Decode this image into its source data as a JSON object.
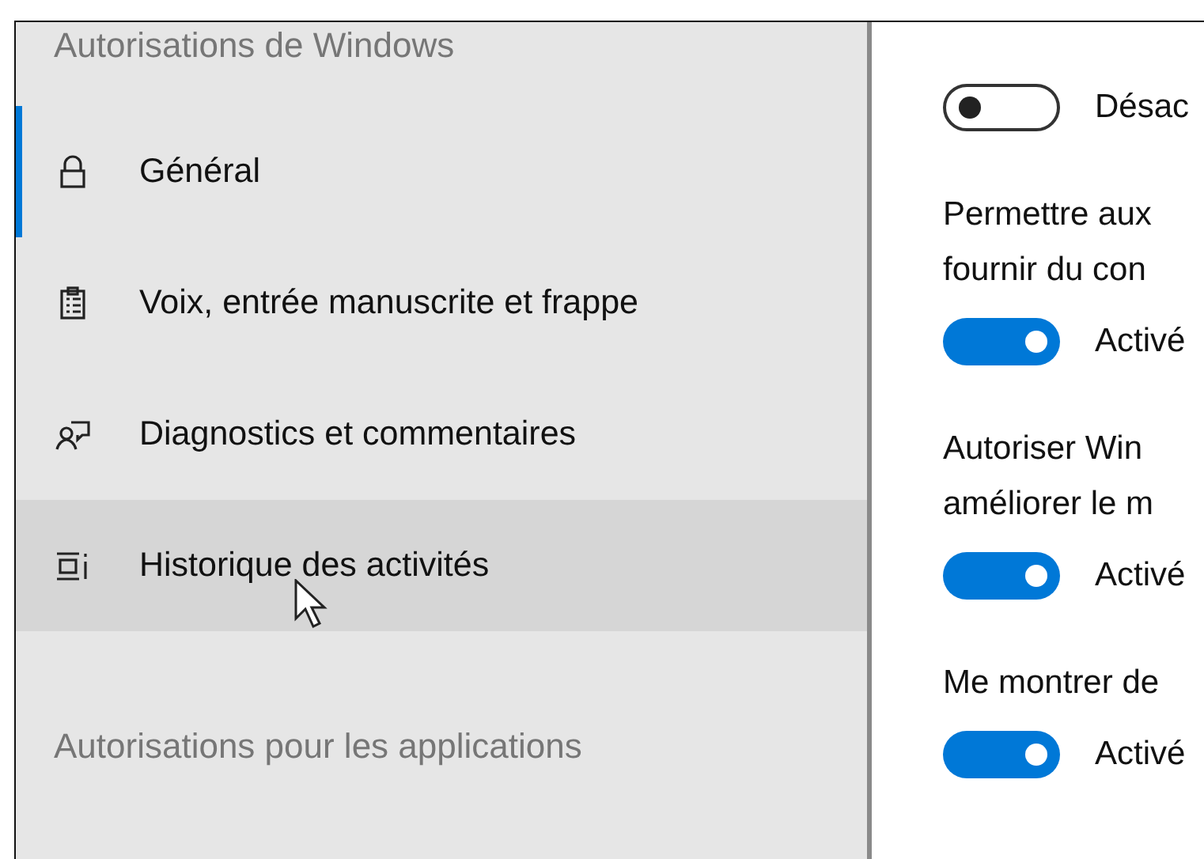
{
  "sidebar": {
    "sections": [
      {
        "header": "Autorisations de Windows",
        "items": [
          {
            "label": "Général",
            "kind": "lock",
            "selected": true,
            "hovered": false
          },
          {
            "label": "Voix, entrée manuscrite et frappe",
            "kind": "clipboard",
            "selected": false,
            "hovered": false
          },
          {
            "label": "Diagnostics et commentaires",
            "kind": "person-chat",
            "selected": false,
            "hovered": false
          },
          {
            "label": "Historique des activités",
            "kind": "timeline",
            "selected": false,
            "hovered": true
          }
        ]
      },
      {
        "header": "Autorisations pour les applications"
      }
    ]
  },
  "settings": [
    {
      "toggle": {
        "on": false,
        "label": "Désac"
      }
    },
    {
      "description": [
        "Permettre aux",
        "fournir du con"
      ],
      "toggle": {
        "on": true,
        "label": "Activé"
      }
    },
    {
      "description": [
        "Autoriser Win",
        "améliorer le m"
      ],
      "toggle": {
        "on": true,
        "label": "Activé"
      }
    },
    {
      "description": [
        "Me montrer de"
      ],
      "toggle": {
        "on": true,
        "label": "Activé"
      }
    }
  ]
}
